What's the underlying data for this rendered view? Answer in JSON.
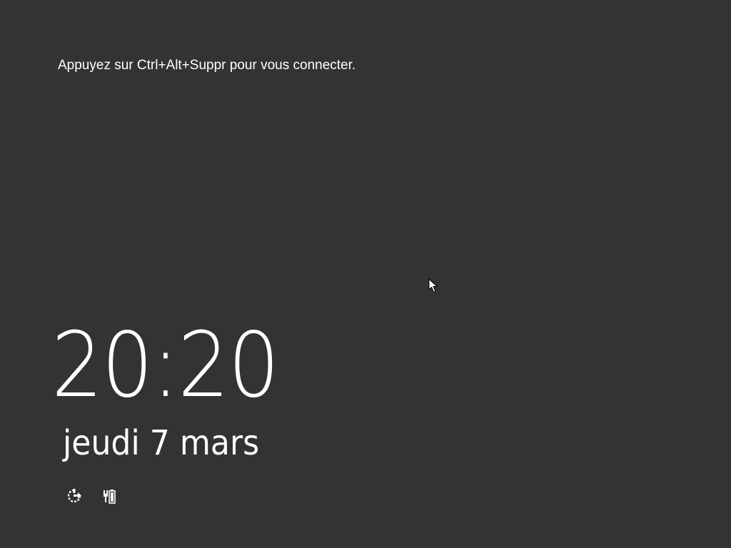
{
  "lockscreen": {
    "hint": "Appuyez sur Ctrl+Alt+Suppr pour vous connecter.",
    "time": "20:20",
    "date": "jeudi 7 mars"
  },
  "status_icons": [
    {
      "icon": "ease-of-access-icon"
    },
    {
      "icon": "battery-charging-icon"
    }
  ],
  "colors": {
    "background": "#333333",
    "text": "#ffffff"
  }
}
